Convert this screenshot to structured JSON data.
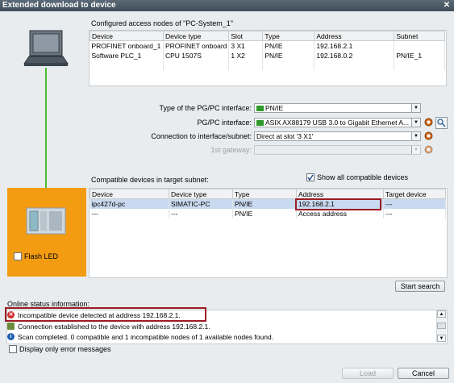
{
  "window": {
    "title": "Extended download to device",
    "close_glyph": "✕"
  },
  "nodes": {
    "heading": "Configured access nodes of \"PC-System_1\"",
    "columns": [
      "Device",
      "Device type",
      "Slot",
      "Type",
      "Address",
      "Subnet"
    ],
    "rows": [
      [
        "PROFINET onboard_1",
        "PROFINET onboard",
        "3 X1",
        "PN/IE",
        "192.168.2.1",
        ""
      ],
      [
        "Software PLC_1",
        "CPU 1507S",
        "1 X2",
        "PN/IE",
        "192.168.0.2",
        "PN/IE_1"
      ]
    ]
  },
  "iface": {
    "type_label": "Type of the PG/PC interface:",
    "type_value": "PN/IE",
    "pgpc_label": "PG/PC interface:",
    "pgpc_value": "ASIX AX88179 USB 3.0 to Gigabit Ethernet A...",
    "conn_label": "Connection to interface/subnet:",
    "conn_value": "Direct at slot '3 X1'",
    "gateway_label": "1st gateway:",
    "gateway_value": ""
  },
  "compat": {
    "heading": "Compatible devices in target subnet:",
    "show_all_label": "Show all compatible devices",
    "columns": [
      "Device",
      "Device type",
      "Type",
      "Address",
      "Target device"
    ],
    "rows": [
      [
        "ipc427d-pc",
        "SIMATIC-PC",
        "PN/IE",
        "192.168.2.1",
        "---"
      ],
      [
        "---",
        "---",
        "PN/IE",
        "Access address",
        "---"
      ]
    ]
  },
  "flash_led_label": "Flash LED",
  "start_search_label": "Start search",
  "status": {
    "heading": "Online status information:",
    "lines": [
      "Incompatible device detected at address 192.168.2.1.",
      "Connection established to the device with address 192.168.2.1.",
      "Scan completed. 0 compatible and 1 incompatible nodes of 1 available nodes found."
    ],
    "error_only_label": "Display only error messages"
  },
  "buttons": {
    "load": "Load",
    "cancel": "Cancel"
  },
  "icons": [
    "laptop-icon",
    "device-icon",
    "network-icon",
    "error-icon",
    "connection-icon",
    "info-icon",
    "diagnostics-icon",
    "properties-icon"
  ],
  "colors": {
    "accent_orange": "#f39c12",
    "link_green": "#4dbb2e",
    "highlight_red": "#9b1b24",
    "selection_blue": "#c9d9ef"
  }
}
